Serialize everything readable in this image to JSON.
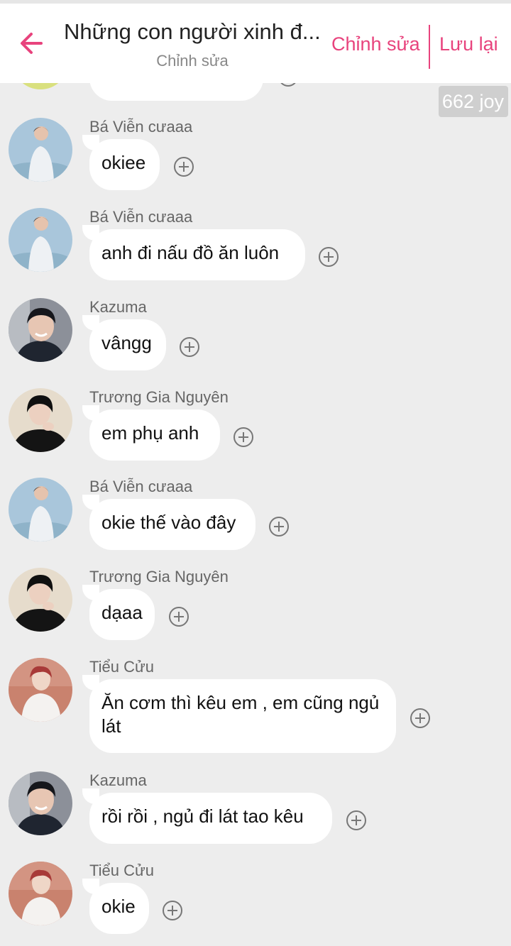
{
  "header": {
    "title": "Những con người xinh đ...",
    "subtitle": "Chỉnh sửa",
    "edit_label": "Chỉnh sửa",
    "save_label": "Lưu lại"
  },
  "joy_badge": "662 joy",
  "messages": [
    {
      "name": "Bá Viễn cưaaa",
      "text": "okiee"
    },
    {
      "name": "Bá Viễn cưaaa",
      "text": "anh đi nấu đồ ăn luôn"
    },
    {
      "name": "Kazuma",
      "text": "vângg"
    },
    {
      "name": "Trương Gia Nguyên",
      "text": "em phụ anh"
    },
    {
      "name": "Bá Viễn cưaaa",
      "text": "okie thế vào đây"
    },
    {
      "name": "Trương Gia Nguyên",
      "text": "dạaa"
    },
    {
      "name": "Tiểu Cửu",
      "text": "Ăn cơm thì kêu em , em cũng ngủ lát"
    },
    {
      "name": "Kazuma",
      "text": "rồi rồi , ngủ đi lát tao kêu"
    },
    {
      "name": "Tiểu Cửu",
      "text": "okie"
    }
  ],
  "colors": {
    "accent": "#e8437d",
    "background": "#ededed"
  }
}
